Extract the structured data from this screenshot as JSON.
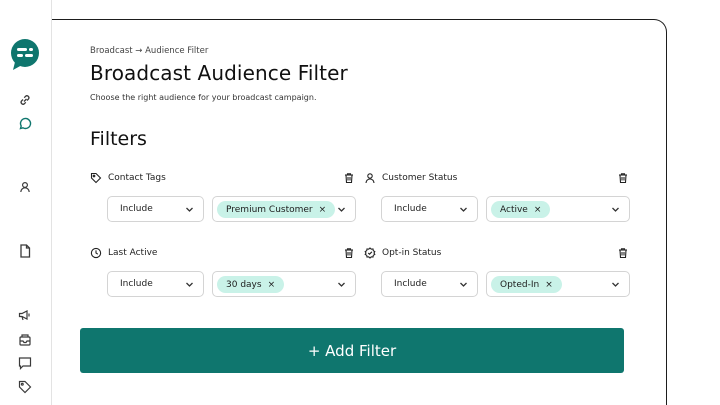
{
  "breadcrumb": "Broadcast → Audience Filter",
  "page": {
    "title": "Broadcast Audience Filter",
    "subtitle": "Choose the right audience for your broadcast campaign.",
    "filters_heading": "Filters"
  },
  "filters": [
    {
      "label": "Contact Tags",
      "icon": "tag-icon",
      "mode": "Include",
      "chip": "Premium Customer"
    },
    {
      "label": "Customer Status",
      "icon": "user-icon",
      "mode": "Include",
      "chip": "Active"
    },
    {
      "label": "Last Active",
      "icon": "clock-icon",
      "mode": "Include",
      "chip": "30 days"
    },
    {
      "label": "Opt-in Status",
      "icon": "badge-check-icon",
      "mode": "Include",
      "chip": "Opted-In"
    }
  ],
  "chip_remove": "×",
  "add_filter_label": "+ Add Filter",
  "colors": {
    "accent": "#0f766e",
    "chip_bg": "#c9f2e8"
  }
}
